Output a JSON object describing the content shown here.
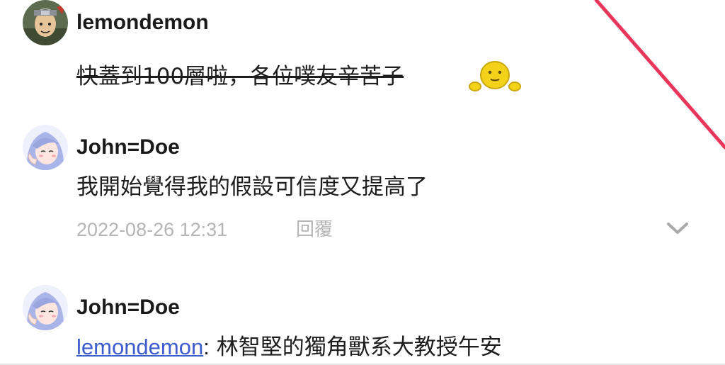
{
  "comments": [
    {
      "username": "lemondemon",
      "text": "快蓋到100層啦，各位噗友辛苦子",
      "strikethrough": true,
      "trailing_icon": "smiley-emoji-icon"
    },
    {
      "username": "John=Doe",
      "text": "我開始覺得我的假設可信度又提高了",
      "timestamp": "2022-08-26 12:31",
      "reply_label": "回覆"
    },
    {
      "username": "John=Doe",
      "mention": "lemondemon",
      "mention_separator": ":",
      "text": " 林智堅的獨角獸系大教授午安"
    }
  ],
  "colors": {
    "accent_line": "#e8365a",
    "mention_link": "#3b5ccc",
    "meta_text": "#b5b5b5",
    "emoji_fill": "#f5d21a"
  }
}
